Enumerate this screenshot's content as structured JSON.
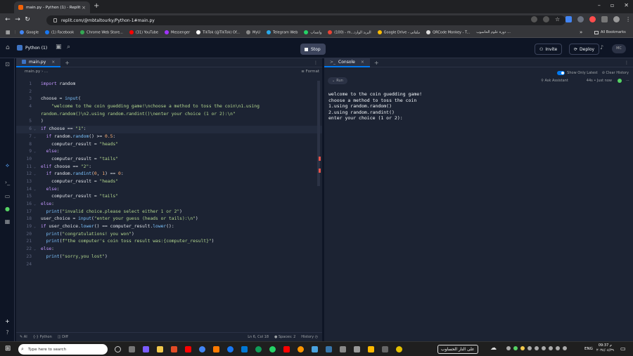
{
  "browser": {
    "tab_title": "main.py - Python (1) - Replit",
    "url": "replit.com/@mbtaltourky/Python-1#main.py",
    "bookmarks": [
      {
        "label": "Google",
        "color": "#4285f4"
      },
      {
        "label": "(1) Facebook",
        "color": "#1877f2"
      },
      {
        "label": "Chrome Web Store...",
        "color": "#34a853"
      },
      {
        "label": "(31) YouTube",
        "color": "#ff0000"
      },
      {
        "label": "Messenger",
        "color": "#a033ff"
      },
      {
        "label": "TikTok (@TikTok) Of...",
        "color": "#ffffff"
      },
      {
        "label": "MyU",
        "color": "#888888"
      },
      {
        "label": "Telegram Web",
        "color": "#29a9eb"
      },
      {
        "label": "واتساب",
        "color": "#25d366"
      },
      {
        "label": "(100) - m...البريد الوارد",
        "color": "#ea4335"
      },
      {
        "label": "Google Drive - ملفاتي",
        "color": "#fbbc04"
      },
      {
        "label": "QRCode Monkey - T...",
        "color": "#dddddd"
      },
      {
        "label": "دورة علوم الحاسوب ..."
      }
    ],
    "all_bookmarks": "All Bookmarks"
  },
  "header": {
    "project": "Python (1)",
    "stop": "Stop",
    "invite": "Invite",
    "deploy": "Deploy",
    "avatar": "MC"
  },
  "editor": {
    "tab": "main.py",
    "breadcrumb": "main.py › ...",
    "format": "Format",
    "lines": [
      {
        "n": "1",
        "fold": "",
        "html": "<span class=\"k\">import</span> random"
      },
      {
        "n": "2",
        "fold": "",
        "html": ""
      },
      {
        "n": "3",
        "fold": "",
        "html": "choose = <span class=\"f\">input</span>("
      },
      {
        "n": "4",
        "fold": "",
        "html": "    <span class=\"s\">\"welcome to the coin guedding game!\\nchoose a method to toss the coin\\n1.using</span>"
      },
      {
        "n": "",
        "fold": "",
        "html": "<span class=\"s\">random.random()\\n2.using random.randint()\\nenter your choice (1 or 2):\\n\"</span>"
      },
      {
        "n": "5",
        "fold": "",
        "html": ")"
      },
      {
        "n": "6",
        "fold": "v",
        "html": "<span class=\"k\">if</span> choose == <span class=\"s\">\"1\"</span>:"
      },
      {
        "n": "7",
        "fold": "v",
        "html": "  <span class=\"k\">if</span> random.<span class=\"f\">random</span>() &gt;= <span class=\"n\">0.5</span>:"
      },
      {
        "n": "8",
        "fold": "",
        "html": "    computer_result = <span class=\"s\">\"heads\"</span>"
      },
      {
        "n": "9",
        "fold": "v",
        "html": "  <span class=\"k\">else</span>:"
      },
      {
        "n": "10",
        "fold": "",
        "html": "    computer_result = <span class=\"s\">\"tails\"</span>"
      },
      {
        "n": "11",
        "fold": "v",
        "html": "<span class=\"k\">elif</span> choose == <span class=\"s\">\"2\"</span>:"
      },
      {
        "n": "12",
        "fold": "v",
        "html": "  <span class=\"k\">if</span> random.<span class=\"f\">randint</span>(<span class=\"n\">0</span>, <span class=\"n\">1</span>) == <span class=\"n\">0</span>:"
      },
      {
        "n": "13",
        "fold": "",
        "html": "    computer_result = <span class=\"s\">\"heads\"</span>"
      },
      {
        "n": "14",
        "fold": "v",
        "html": "  <span class=\"k\">else</span>:"
      },
      {
        "n": "15",
        "fold": "",
        "html": "    computer_result = <span class=\"s\">\"tails\"</span>"
      },
      {
        "n": "16",
        "fold": "v",
        "html": "<span class=\"k\">else</span>:"
      },
      {
        "n": "17",
        "fold": "",
        "html": "  <span class=\"f\">print</span>(<span class=\"s\">\"invalid choice.please select either 1 or 2\"</span>)"
      },
      {
        "n": "18",
        "fold": "",
        "html": "user_choice = <span class=\"f\">input</span>(<span class=\"s\">\"enter your guess (heads or tails):\\n\"</span>)"
      },
      {
        "n": "19",
        "fold": "v",
        "html": "<span class=\"k\">if</span> user_choice.<span class=\"f\">lower</span>() == computer_result.<span class=\"f\">lower</span>():"
      },
      {
        "n": "20",
        "fold": "",
        "html": "  <span class=\"f\">print</span>(<span class=\"s\">\"congratulations! you won\"</span>)"
      },
      {
        "n": "21",
        "fold": "",
        "html": "  <span class=\"f\">print</span>(<span class=\"s\">f\"the computer's coin toss result was:{computer_result}\"</span>)"
      },
      {
        "n": "22",
        "fold": "v",
        "html": "<span class=\"k\">else</span>:"
      },
      {
        "n": "23",
        "fold": "",
        "html": "  <span class=\"f\">print</span>(<span class=\"s\">\"sorry,you lost\"</span>)"
      },
      {
        "n": "24",
        "fold": "",
        "html": ""
      }
    ],
    "status_ai": "AI",
    "status_lang": "Python",
    "status_diff": "Diff",
    "status_pos": "Ln 6, Col 18",
    "status_spaces": "Spaces: 2",
    "status_history": "History"
  },
  "console": {
    "tab": "Console",
    "show_only_latest": "Show Only Latest",
    "clear_history": "Clear History",
    "run": "Run",
    "ask_assistant": "Ask Assistant",
    "timing": "44s • Just now",
    "output": "welcome to the coin guedding game!\nchoose a method to toss the coin\n1.using random.random()\n2.using random.randint()\nenter your choice (1 or 2):"
  },
  "taskbar": {
    "search": "Type here to search",
    "arabic_box": "على النار الحساوب",
    "lang": "ENG",
    "time": "09:37 م",
    "date": "٢٠٢٤/٠٤/٢٩"
  }
}
